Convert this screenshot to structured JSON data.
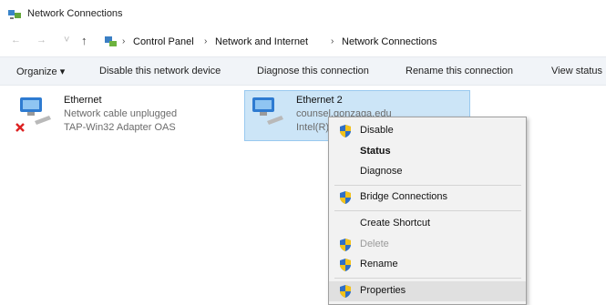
{
  "window": {
    "title": "Network Connections"
  },
  "address": {
    "crumbs": [
      "Control Panel",
      "Network and Internet",
      "Network Connections"
    ]
  },
  "toolbar": {
    "organize": "Organize ▾",
    "disable": "Disable this network device",
    "diagnose": "Diagnose this connection",
    "rename": "Rename this connection",
    "view_status": "View status"
  },
  "connections": [
    {
      "name": "Ethernet",
      "status": "Network cable unplugged",
      "adapter": "TAP-Win32 Adapter OAS"
    },
    {
      "name": "Ethernet 2",
      "status": "counsel.gonzaga.edu",
      "adapter": "Intel(R) ..."
    }
  ],
  "context_menu": {
    "items": [
      {
        "label": "Disable",
        "shield": true
      },
      {
        "label": "Status",
        "bold": true
      },
      {
        "label": "Diagnose"
      },
      {
        "label": "Bridge Connections",
        "shield": true
      },
      {
        "label": "Create Shortcut"
      },
      {
        "label": "Delete",
        "shield": true,
        "disabled": true
      },
      {
        "label": "Rename",
        "shield": true
      },
      {
        "label": "Properties",
        "shield": true,
        "hover": true
      }
    ]
  },
  "colors": {
    "selection": "#cce5f7",
    "selection_border": "#99c9ef",
    "menu_bg": "#f2f2f2"
  }
}
